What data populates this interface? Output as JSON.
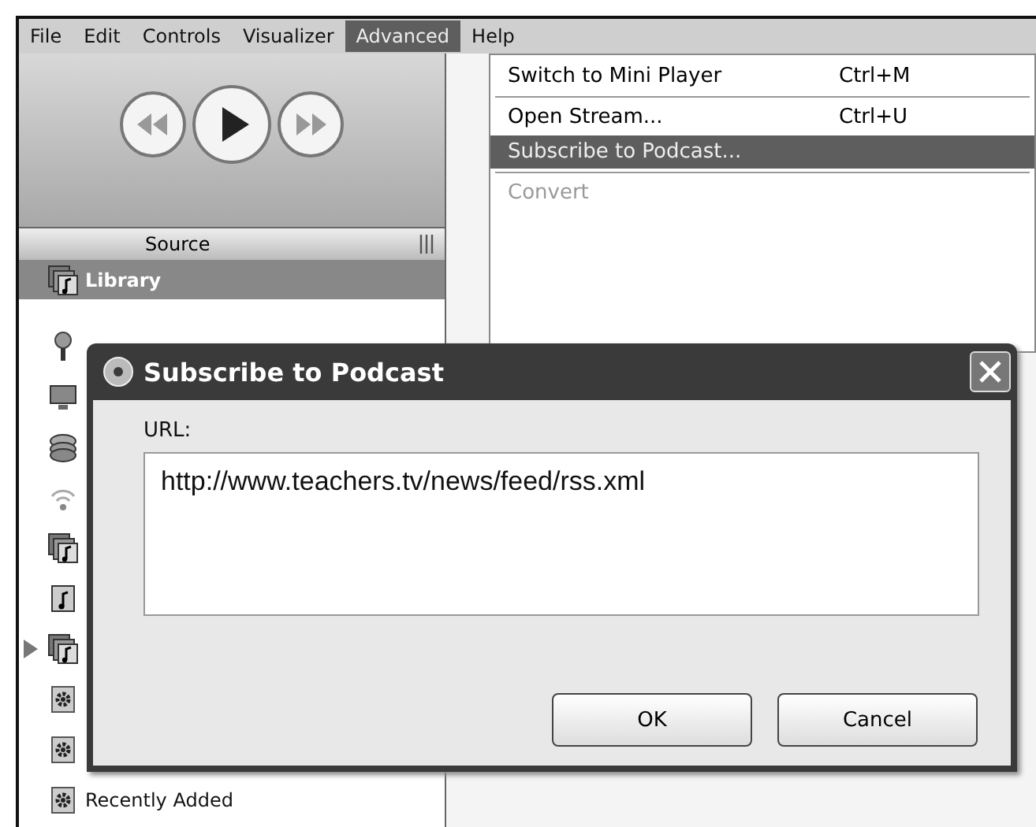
{
  "menu_bar": [
    {
      "label": "File",
      "selected": false
    },
    {
      "label": "Edit",
      "selected": false
    },
    {
      "label": "Controls",
      "selected": false
    },
    {
      "label": "Visualizer",
      "selected": false
    },
    {
      "label": "Advanced",
      "selected": true
    },
    {
      "label": "Help",
      "selected": false
    }
  ],
  "source_header": "Source",
  "sidebar": {
    "items": [
      {
        "kind": "library",
        "label": "Library",
        "selected": true,
        "playing": false
      },
      {
        "kind": "podcast",
        "selected": false,
        "playing": false
      },
      {
        "kind": "tv",
        "selected": false,
        "playing": false
      },
      {
        "kind": "cd",
        "selected": false,
        "playing": false
      },
      {
        "kind": "radio",
        "selected": false,
        "playing": false
      },
      {
        "kind": "library",
        "selected": false,
        "playing": false
      },
      {
        "kind": "playlist",
        "selected": false,
        "playing": false
      },
      {
        "kind": "library",
        "selected": false,
        "playing": true
      },
      {
        "kind": "smart",
        "selected": false,
        "playing": false
      },
      {
        "kind": "smart",
        "selected": false,
        "playing": false
      },
      {
        "kind": "smart",
        "label": "Recently Added",
        "selected": false,
        "playing": false
      }
    ]
  },
  "dropdown": [
    {
      "kind": "item",
      "label": "Switch to Mini Player",
      "shortcut": "Ctrl+M",
      "selected": false,
      "disabled": false
    },
    {
      "kind": "separator"
    },
    {
      "kind": "item",
      "label": "Open Stream...",
      "shortcut": "Ctrl+U",
      "selected": false,
      "disabled": false
    },
    {
      "kind": "item",
      "label": "Subscribe to Podcast...",
      "selected": true,
      "disabled": false
    },
    {
      "kind": "separator"
    },
    {
      "kind": "item",
      "label": "Convert",
      "selected": false,
      "disabled": true
    }
  ],
  "dialog": {
    "title": "Subscribe to Podcast",
    "label": "URL:",
    "value": "http://www.teachers.tv/news/feed/rss.xml",
    "buttons": [
      "OK",
      "Cancel"
    ]
  }
}
